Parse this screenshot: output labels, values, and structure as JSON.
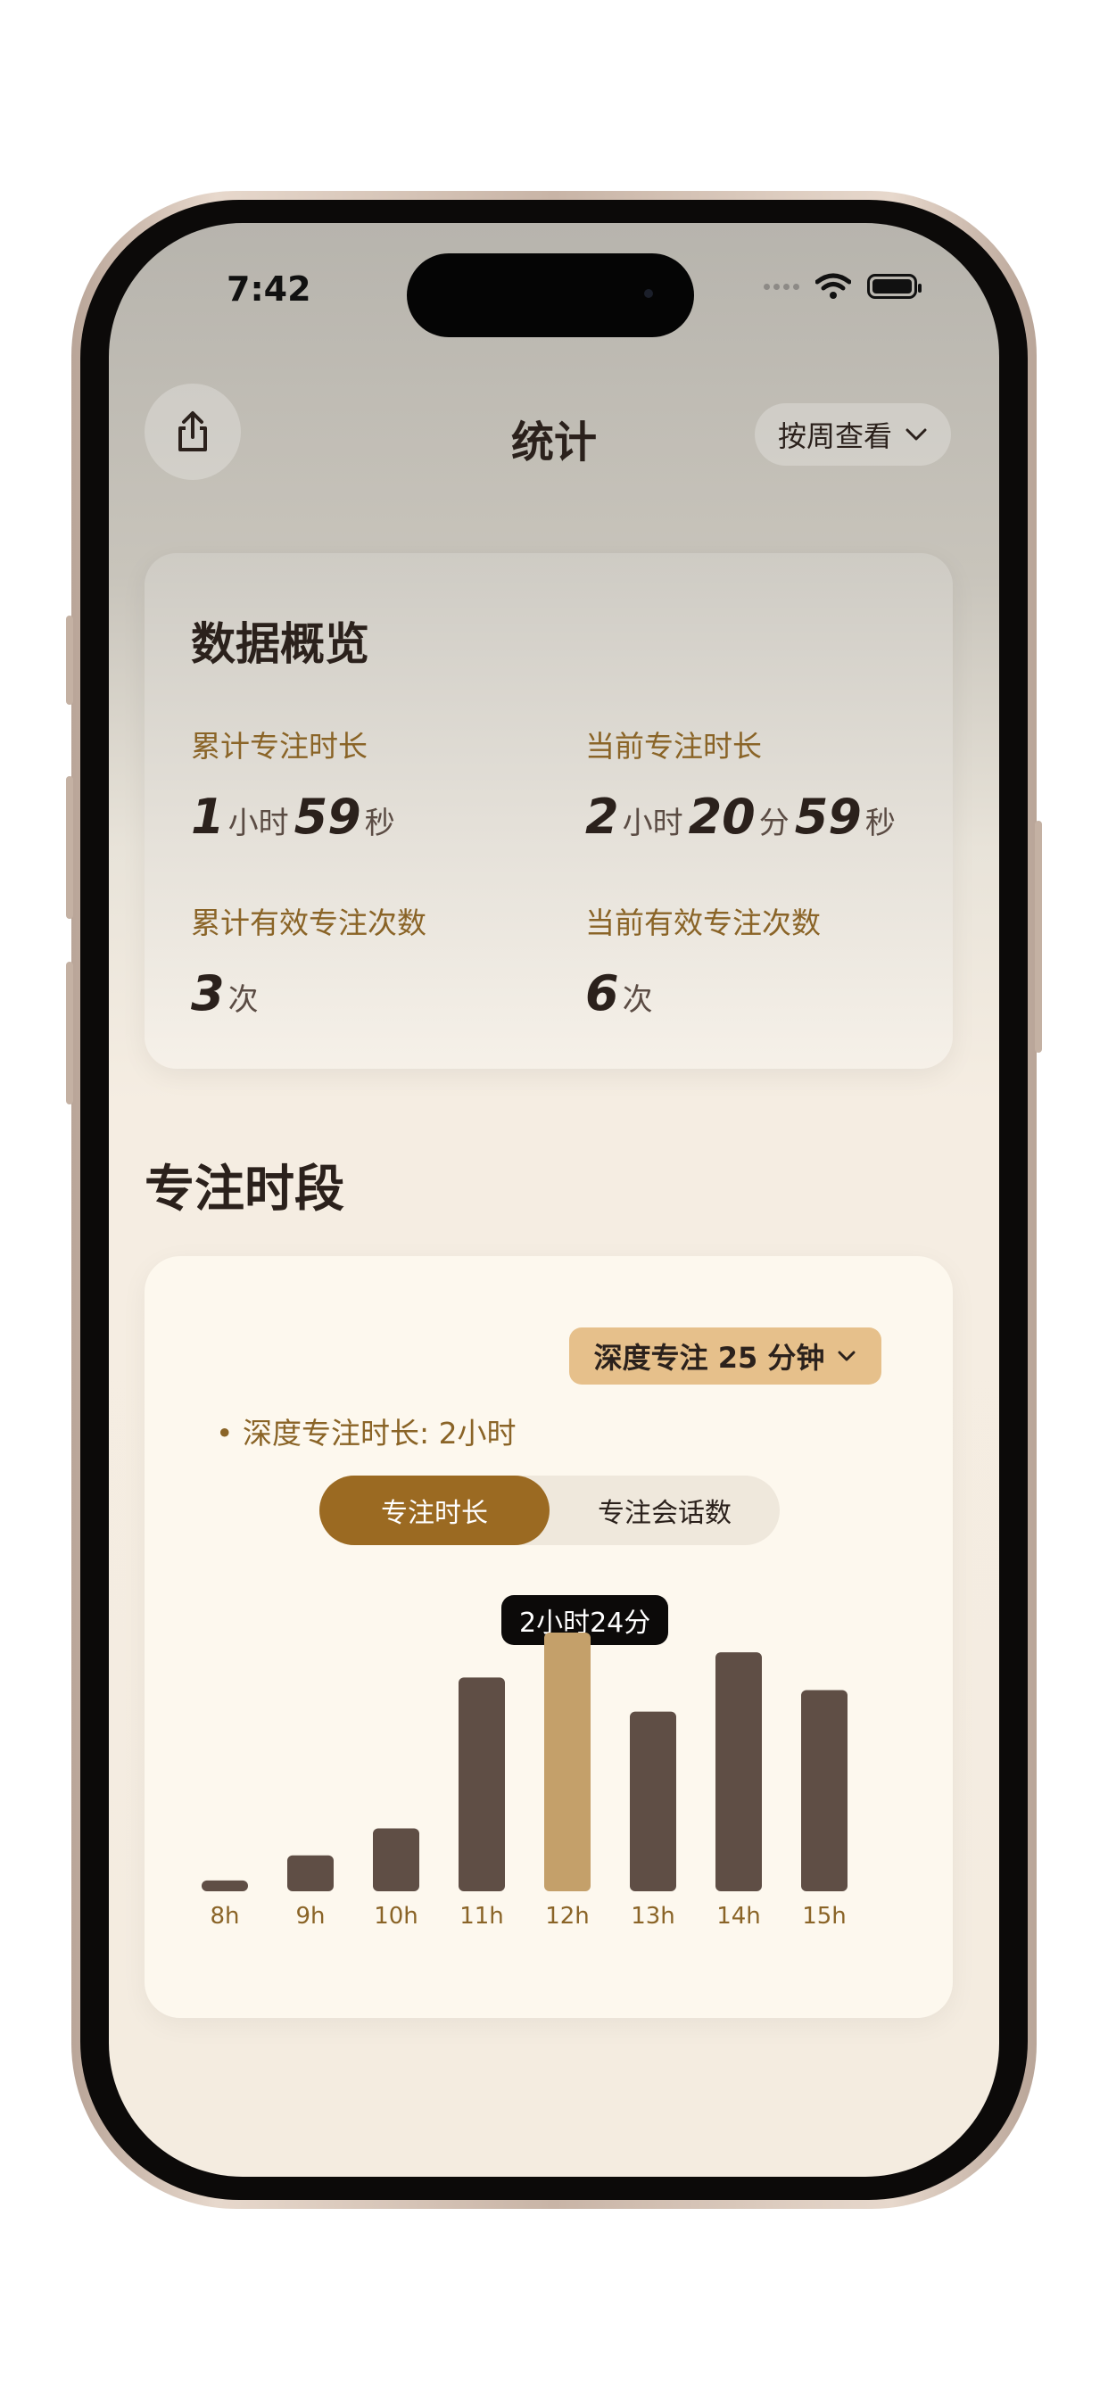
{
  "status_bar": {
    "time": "7:42",
    "icons": [
      "signal-dots-icon",
      "wifi-icon",
      "battery-icon"
    ]
  },
  "nav": {
    "share_icon": "share-icon",
    "title": "统计",
    "view_select": "按周查看",
    "view_select_icon": "chevron-down-icon"
  },
  "overview": {
    "title": "数据概览",
    "total_focus_duration": {
      "label": "累计专注时长",
      "parts": [
        {
          "num": "1",
          "unit": "小时"
        },
        {
          "num": "59",
          "unit": "秒"
        }
      ]
    },
    "current_focus_duration": {
      "label": "当前专注时长",
      "parts": [
        {
          "num": "2",
          "unit": "小时"
        },
        {
          "num": "20",
          "unit": "分"
        },
        {
          "num": "59",
          "unit": "秒"
        }
      ]
    },
    "total_valid_sessions": {
      "label": "累计有效专注次数",
      "num": "3",
      "unit": "次"
    },
    "current_valid_sessions": {
      "label": "当前有效专注次数",
      "num": "6",
      "unit": "次"
    }
  },
  "focus_period": {
    "section_title": "专注时段",
    "depth_select": "深度专注 25 分钟",
    "depth_note": "• 深度专注时长: 2小时",
    "tabs": [
      {
        "label": "专注时长",
        "active": true
      },
      {
        "label": "专注会话数",
        "active": false
      }
    ],
    "tooltip": "2小时24分"
  },
  "colors": {
    "accent": "#9b6a22",
    "bar": "#5f4e45",
    "bar_highlight": "#c4a06a",
    "label": "#8a6427"
  },
  "chart_data": {
    "type": "bar",
    "categories": [
      "8h",
      "9h",
      "10h",
      "11h",
      "12h",
      "13h",
      "14h",
      "15h"
    ],
    "values": [
      6,
      20,
      35,
      119,
      144,
      100,
      133,
      112
    ],
    "highlight_index": 4,
    "highlight_label": "2小时24分",
    "title": "",
    "xlabel": "",
    "ylabel": "",
    "ylim": [
      0,
      144
    ],
    "grid": false
  }
}
